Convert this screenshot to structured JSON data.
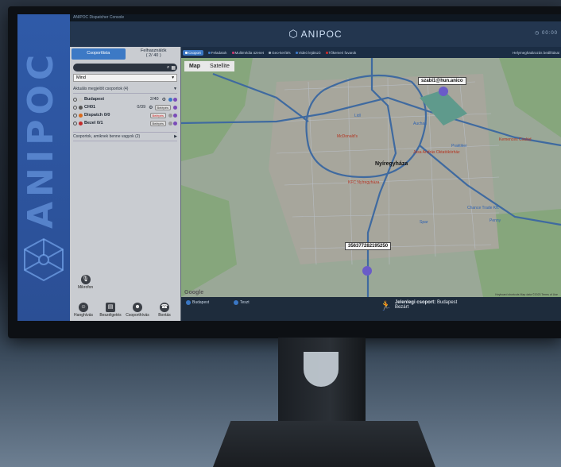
{
  "window": {
    "title": "ANIPOC Dispatcher Console"
  },
  "brand": {
    "name": "ANIPOC",
    "strip_text": "ANIPOC"
  },
  "header": {
    "logo": "ANIPOC",
    "clock": "00:00"
  },
  "sidebar": {
    "tabs": [
      {
        "label": "Csoportlista",
        "active": true
      },
      {
        "label": "Felhasználók",
        "sub": "( 2/ 40 )",
        "active": false
      }
    ],
    "search": {
      "placeholder": ""
    },
    "filter": {
      "value": "Mind"
    },
    "section_title": "Aktuális megjelölt csoportok (4)",
    "groups": [
      {
        "name": "Budapest",
        "count": "2/40",
        "dot": "#c8c8c8",
        "pill": "Belépés"
      },
      {
        "name": "CH01",
        "count": "0/39",
        "dot": "#555555",
        "pill": "Belépés"
      },
      {
        "name": "Dispatch 0/0",
        "count": "",
        "dot": "#d96a1c",
        "pill": "Belépés",
        "red": true
      },
      {
        "name": "Bezel 0/1",
        "count": "",
        "dot": "#c22a2a",
        "pill": "Belépés"
      }
    ],
    "footer_section": "Csoportok, amiknek benne vagyok (2)",
    "mic_label": "Mikrofon",
    "tools": [
      {
        "label": "Hanghívás",
        "icon": "person-icon"
      },
      {
        "label": "Beszélgetés",
        "icon": "chat-icon"
      },
      {
        "label": "Csoporthívás",
        "icon": "group-icon"
      },
      {
        "label": "Bontás",
        "icon": "hangup-icon"
      }
    ]
  },
  "map_tabs": [
    {
      "label": "Csoport",
      "active": true,
      "color": "#ffffff"
    },
    {
      "label": "Feladatok",
      "color": "#3a77c4"
    },
    {
      "label": "Multimédia üzenet",
      "color": "#c23a6e"
    },
    {
      "label": "Geo-kerítés",
      "color": "#9aa9b8"
    },
    {
      "label": "Videó lejátszó",
      "color": "#3a77c4"
    },
    {
      "label": "Tőkemeri fuvarok",
      "color": "#c22a2a"
    }
  ],
  "map_tabs_right": "Helymeghatározás beállításai",
  "map": {
    "type_buttons": [
      "Map",
      "Satellite"
    ],
    "callout_user": "szabi1@hun.anico",
    "callout_device": "356377282195250",
    "city": "Nyíregyháza",
    "google": "Google",
    "footer": "Keyboard shortcuts   Map data ©2023   Terms of Use",
    "labels": [
      {
        "text": "McDonald's",
        "kind": "red"
      },
      {
        "text": "Lidl",
        "kind": "blue"
      },
      {
        "text": "Auchan",
        "kind": "blue"
      },
      {
        "text": "KFC Nyíregyháza",
        "kind": "red"
      },
      {
        "text": "Jósa András Oktatókórház",
        "kind": "red"
      },
      {
        "text": "Praktiker",
        "kind": "blue"
      },
      {
        "text": "Kemences Család",
        "kind": "red"
      },
      {
        "text": "Penny",
        "kind": "blue"
      },
      {
        "text": "Spar",
        "kind": "blue"
      },
      {
        "text": "Chance Trade Kft.",
        "kind": "blue"
      }
    ]
  },
  "status_bar": {
    "left_item": "Budapest",
    "mid_item": "Teszt",
    "current_group_label": "Jelenlegi csoport:",
    "current_group_value": "Budapest",
    "current_group_sub": "Bezárt"
  }
}
